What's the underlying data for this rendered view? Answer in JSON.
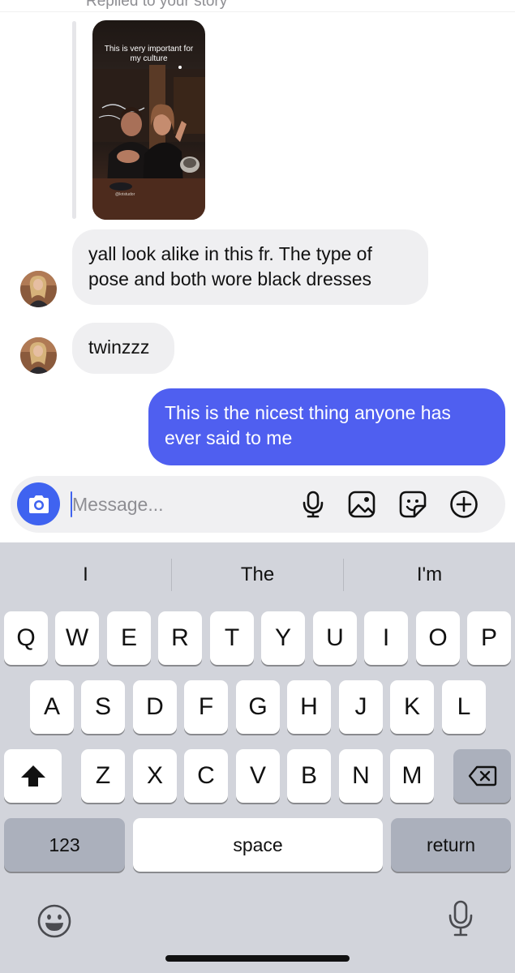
{
  "thread": {
    "replied_label": "Replied to your story",
    "story": {
      "caption": "This is very important for my culture",
      "handle": "@kristudor"
    },
    "messages": [
      {
        "from": "them",
        "text": "yall look alike in this fr. The type of pose and both wore black dresses"
      },
      {
        "from": "them",
        "text": "twinzzz"
      },
      {
        "from": "me",
        "text": "This is the nicest thing anyone has ever said to me"
      }
    ]
  },
  "composer": {
    "placeholder": "Message...",
    "value": "",
    "icons": [
      "camera-icon",
      "microphone-icon",
      "gallery-icon",
      "sticker-icon",
      "plus-icon"
    ],
    "accent_color": "#3f63f0"
  },
  "keyboard": {
    "suggestions": [
      "I",
      "The",
      "I'm"
    ],
    "row1": [
      "Q",
      "W",
      "E",
      "R",
      "T",
      "Y",
      "U",
      "I",
      "O",
      "P"
    ],
    "row2": [
      "A",
      "S",
      "D",
      "F",
      "G",
      "H",
      "J",
      "K",
      "L"
    ],
    "row3": [
      "Z",
      "X",
      "C",
      "V",
      "B",
      "N",
      "M"
    ],
    "numbers_label": "123",
    "space_label": "space",
    "return_label": "return",
    "icons": [
      "shift-icon",
      "backspace-icon",
      "emoji-icon",
      "dictation-icon"
    ]
  },
  "colors": {
    "outgoing_bubble": "#4f5ff0",
    "incoming_bubble": "#efeff1",
    "keyboard_bg": "#d2d4db"
  }
}
